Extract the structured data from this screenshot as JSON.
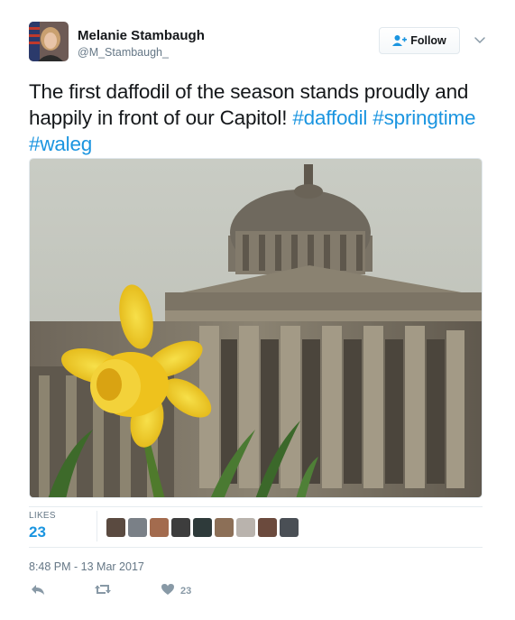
{
  "author": {
    "name": "Melanie Stambaugh",
    "handle": "@M_Stambaugh_"
  },
  "header": {
    "follow_label": "Follow"
  },
  "tweet": {
    "text": "The first daffodil of the season stands proudly and happily in front of our Capitol! ",
    "hashtags": [
      "#daffodil",
      "#springtime",
      "#waleg"
    ]
  },
  "stats": {
    "likes_label": "LIKES",
    "likes_count": "23"
  },
  "timestamp": "8:48 PM - 13 Mar 2017",
  "actions": {
    "like_count": "23"
  },
  "icons": [
    "follow-icon",
    "chevron-down-icon",
    "reply-icon",
    "retweet-icon",
    "like-icon"
  ],
  "colors": {
    "link": "#1b95e0",
    "secondary_text": "#657786",
    "action_icon": "#8899a6"
  }
}
